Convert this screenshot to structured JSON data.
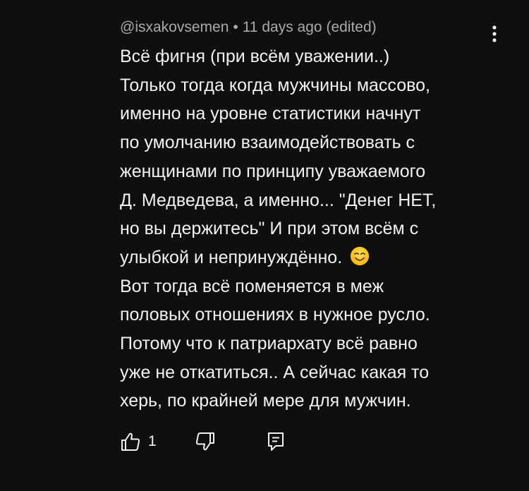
{
  "comment": {
    "author": "@isxakovsemen",
    "separator": "•",
    "timestamp": "11 days ago",
    "edited": "(edited)",
    "lines": [
      "Всё фигня (при всём уважении..)",
      "Только тогда когда мужчины массово,",
      "именно на уровне статистики начнут",
      "по умолчанию взаимодействовать с",
      "женщинами по принципу уважаемого",
      "Д. Медведева, а именно... \"Денег НЕТ,",
      "но вы держитесь\" И при этом всём с",
      "улыбкой и непринуждённо.",
      "Вот тогда всё поменяется в меж",
      "половых отношениях в нужное русло.",
      "Потому что к патриархату всё равно",
      "уже не откатиться.. А сейчас какая то",
      "херь, по крайней мере для мужчин."
    ],
    "emoji": "smiling-face-emoji",
    "like_count": "1"
  },
  "icons": {
    "menu": "kebab-menu-icon",
    "like": "thumb-up-icon",
    "dislike": "thumb-down-icon",
    "reply": "reply-icon"
  },
  "colors": {
    "background": "#0f0f0f",
    "text": "#f1f1f1",
    "meta": "#aaaaaa"
  }
}
